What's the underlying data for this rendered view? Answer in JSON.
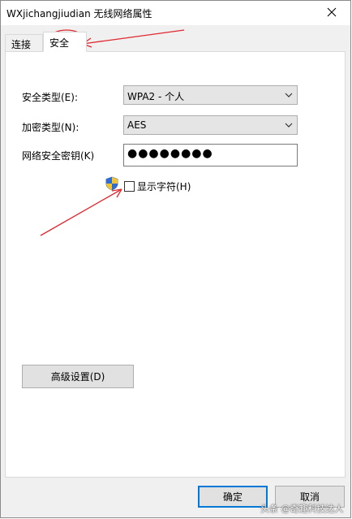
{
  "window": {
    "title": "WXjichangjiudian 无线网络属性"
  },
  "tabs": [
    {
      "label": "连接"
    },
    {
      "label": "安全"
    }
  ],
  "security": {
    "type_label": "安全类型(E):",
    "type_value": "WPA2 - 个人",
    "encryption_label": "加密类型(N):",
    "encryption_value": "AES",
    "key_label": "网络安全密钥(K)",
    "key_masked": "●●●●●●●●",
    "show_chars_label": "显示字符(H)",
    "show_chars_checked": false
  },
  "buttons": {
    "advanced": "高级设置(D)",
    "ok": "确定",
    "cancel": "取消"
  },
  "watermark": "头条 @奇趣科技达人",
  "colors": {
    "accent": "#0078d7",
    "annotation": "#e0282e"
  },
  "icons": {
    "close": "close-icon",
    "dropdown": "chevron-down-icon",
    "shield": "uac-shield-icon"
  }
}
